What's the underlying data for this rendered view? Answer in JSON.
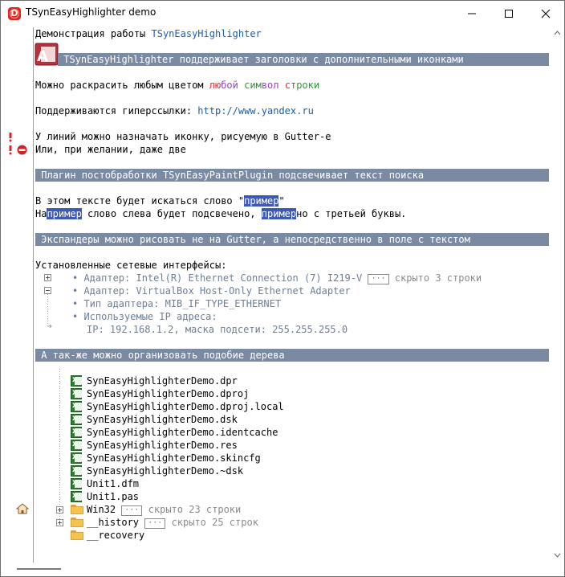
{
  "window": {
    "title": "TSynEasyHighlighter demo"
  },
  "lines": {
    "l1_text": "Демонстрация работы ",
    "l1_name": "TSynEasyHighlighter",
    "hdr1": " TSynEasyHighlighter поддерживает заголовки с дополнительными иконками",
    "l3_pre": "Можно раскрасить любым цветом ",
    "l3_w1a": "лю",
    "l3_w1b": "бой",
    "l3_sp1": " ",
    "l3_w2a": "сим",
    "l3_w2b": "вол",
    "l3_sp2": " ",
    "l3_w3a": "ст",
    "l3_w3b": "роки",
    "l4_pre": "Поддерживаются гиперссылки: ",
    "l4_link": "http://www.yandex.ru",
    "l5": "У линий можно назначать иконку, рисуемую в Gutter-е",
    "l6": "Или, при желании, даже две",
    "hdr2": " Плагин постобработки TSynEasyPaintPlugin подсвечивает текст поиска",
    "l8_pre": "В этом тексте будет искаться слово \"",
    "l8_hl": "пример",
    "l8_post": "\"",
    "l9_a": "На",
    "l9_hl1": "пример",
    "l9_b": " слово слева будет подсвечено, ",
    "l9_hl2": "пример",
    "l9_c": "но с третьей буквы.",
    "hdr3": " Экспандеры можно рисовать не на Gutter, а непосредственно в поле с текстом",
    "l11": "Установленные сетевые интерфейсы:",
    "exp1_text": "• Адаптер: Intel(R) Ethernet Connection (7) I219-V ",
    "exp1_badge": "···",
    "exp1_hint": " скрыто 3 строки",
    "exp2_text": "• Адаптер: VirtualBox Host-Only Ethernet Adapter",
    "exp3_text": "• Тип адаптера: MIB_IF_TYPE_ETHERNET",
    "exp4_text": "• Используемые IP адреса:",
    "exp5_text": "IP: 192.168.1.2, маска подсети: 255.255.255.0",
    "hdr4": " А так-же можно организовать подобие дерева"
  },
  "tree": {
    "files": [
      "SynEasyHighlighterDemo.dpr",
      "SynEasyHighlighterDemo.dproj",
      "SynEasyHighlighterDemo.dproj.local",
      "SynEasyHighlighterDemo.dsk",
      "SynEasyHighlighterDemo.identcache",
      "SynEasyHighlighterDemo.res",
      "SynEasyHighlighterDemo.skincfg",
      "SynEasyHighlighterDemo.~dsk",
      "Unit1.dfm",
      "Unit1.pas"
    ],
    "folders": [
      {
        "name": "Win32",
        "badge": "···",
        "hint": " скрыто 23 строки"
      },
      {
        "name": "__history",
        "badge": "···",
        "hint": " скрыто 25 строк"
      },
      {
        "name": "__recovery",
        "badge": "",
        "hint": ""
      }
    ]
  },
  "gutter_icons": [
    "exclamation-icon",
    "exclamation-icon",
    "no-entry-icon",
    "home-icon"
  ],
  "colors": {
    "header_bg": "#7b8aa3",
    "highlight_bg": "#3d59b4",
    "link": "#1560a8"
  }
}
